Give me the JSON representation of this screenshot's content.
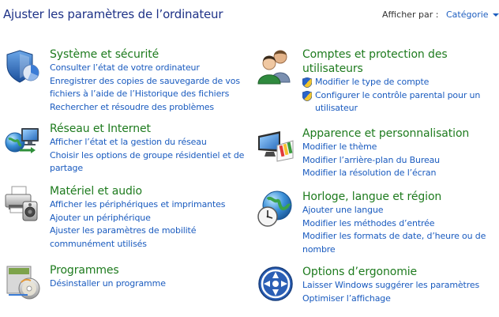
{
  "header": {
    "title": "Ajuster les paramètres de l’ordinateur",
    "view_by_label": "Afficher par :",
    "view_by_value": "Catégorie"
  },
  "left": [
    {
      "title": "Système et sécurité",
      "icon": "shield-pie-icon",
      "links": [
        "Consulter l’état de votre ordinateur",
        "Enregistrer des copies de sauvegarde de vos fichiers à l’aide de l’Historique des fichiers",
        "Rechercher et résoudre des problèmes"
      ]
    },
    {
      "title": "Réseau et Internet",
      "icon": "network-globe-icon",
      "links": [
        "Afficher l’état et la gestion du réseau",
        "Choisir les options de groupe résidentiel et de partage"
      ]
    },
    {
      "title": "Matériel et audio",
      "icon": "printer-speaker-icon",
      "links": [
        "Afficher les périphériques et imprimantes",
        "Ajouter un périphérique",
        "Ajuster les paramètres de mobilité communément utilisés"
      ]
    },
    {
      "title": "Programmes",
      "icon": "programs-box-icon",
      "links": [
        "Désinstaller un programme"
      ]
    }
  ],
  "right": [
    {
      "title": "Comptes et protection des utilisateurs",
      "icon": "users-icon",
      "links": [
        "Modifier le type de compte",
        "Configurer le contrôle parental pour un utilisateur"
      ]
    },
    {
      "title": "Apparence et personnalisation",
      "icon": "monitor-palette-icon",
      "links": [
        "Modifier le thème",
        "Modifier l’arrière-plan du Bureau",
        "Modifier la résolution de l’écran"
      ]
    },
    {
      "title": "Horloge, langue et région",
      "icon": "clock-globe-icon",
      "links": [
        "Ajouter une langue",
        "Modifier les méthodes d’entrée",
        "Modifier les formats de date, d’heure ou de nombre"
      ]
    },
    {
      "title": "Options d’ergonomie",
      "icon": "ease-of-access-icon",
      "links": [
        "Laisser Windows suggérer les paramètres",
        "Optimiser l’affichage"
      ]
    }
  ]
}
